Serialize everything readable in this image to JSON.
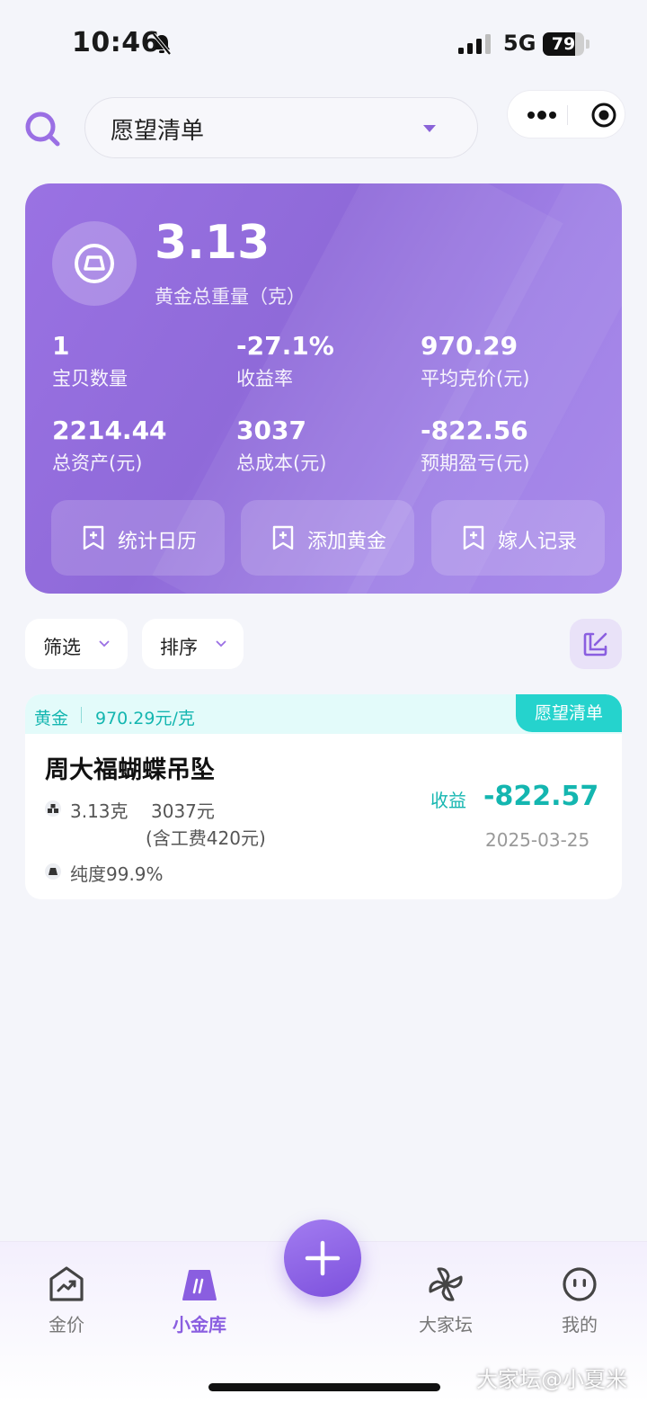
{
  "status_bar": {
    "time": "10:46",
    "network": "5G",
    "battery": "79",
    "battery_level": 0.79
  },
  "header": {
    "list_name": "愿望清单"
  },
  "summary": {
    "total_weight": "3.13",
    "total_weight_label": "黄金总重量（克）",
    "stats": [
      {
        "value": "1",
        "label": "宝贝数量"
      },
      {
        "value": "-27.1%",
        "label": "收益率"
      },
      {
        "value": "970.29",
        "label": "平均克价(元)"
      },
      {
        "value": "2214.44",
        "label": "总资产(元)"
      },
      {
        "value": "3037",
        "label": "总成本(元)"
      },
      {
        "value": "-822.56",
        "label": "预期盈亏(元)"
      }
    ],
    "actions": [
      {
        "label": "统计日历",
        "icon": "bookmark-plus-icon"
      },
      {
        "label": "添加黄金",
        "icon": "bookmark-plus-icon"
      },
      {
        "label": "嫁人记录",
        "icon": "bookmark-plus-icon"
      }
    ]
  },
  "filters": {
    "filter_label": "筛选",
    "sort_label": "排序"
  },
  "items": [
    {
      "type": "黄金",
      "unit_price": "970.29元/克",
      "tag": "愿望清单",
      "name": "周大福蝴蝶吊坠",
      "weight": "3.13克",
      "cost": "3037元",
      "fee_note": "(含工费420元)",
      "purity": "纯度99.9%",
      "profit_label": "收益",
      "profit": "-822.57",
      "date": "2025-03-25"
    }
  ],
  "bottom_nav": {
    "items": [
      {
        "label": "金价",
        "icon": "trend-chart-icon"
      },
      {
        "label": "小金库",
        "icon": "gold-bar-icon",
        "active": true
      },
      {
        "label": "大家坛",
        "icon": "pinwheel-icon"
      },
      {
        "label": "我的",
        "icon": "smiley-icon"
      }
    ]
  },
  "watermark": "大家坛@小夏米",
  "colors": {
    "accent": "#8a5ee0",
    "card": "#9a72e3",
    "teal": "#14b6b0",
    "tag": "#25d3cd"
  }
}
